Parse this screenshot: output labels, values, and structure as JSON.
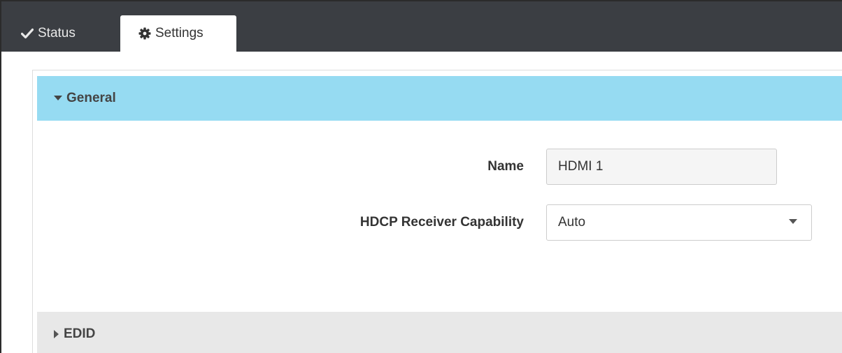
{
  "tabs": [
    {
      "label": "Status",
      "icon": "check-icon",
      "active": false
    },
    {
      "label": "Settings",
      "icon": "gear-icon",
      "active": true
    }
  ],
  "sections": {
    "general": {
      "title": "General",
      "expanded": true
    },
    "edid": {
      "title": "EDID",
      "expanded": false
    }
  },
  "form": {
    "name": {
      "label": "Name",
      "value": "HDMI 1"
    },
    "hdcp": {
      "label": "HDCP Receiver Capability",
      "selected": "Auto"
    }
  },
  "colors": {
    "tabbar_bg": "#3b3e43",
    "general_header_bg": "#96dbf2",
    "edid_header_bg": "#e8e8e8"
  }
}
